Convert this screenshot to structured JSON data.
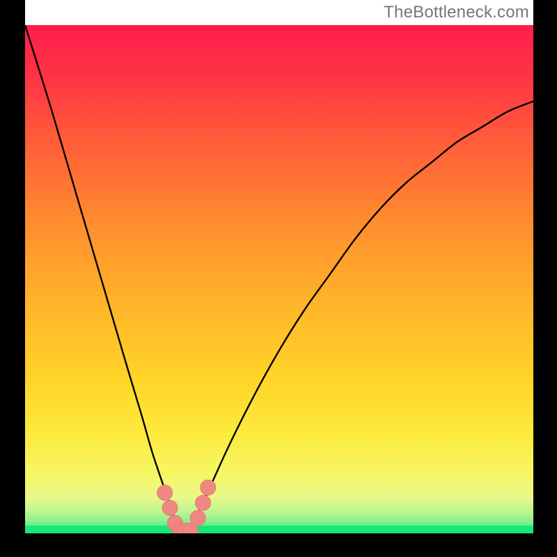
{
  "attribution": "TheBottleneck.com",
  "colors": {
    "frame": "#000000",
    "attribution_bg": "#ffffff",
    "attribution_text": "#757575",
    "curve": "#000000",
    "marker_fill": "#ef8783",
    "marker_stroke": "#e77874",
    "floor": "#17e87a"
  },
  "chart_data": {
    "type": "line",
    "title": "",
    "xlabel": "",
    "ylabel": "",
    "xlim": [
      0,
      100
    ],
    "ylim": [
      0,
      100
    ],
    "grid": false,
    "legend": false,
    "series": [
      {
        "name": "bottleneck-curve",
        "x": [
          0,
          5,
          10,
          15,
          20,
          23,
          25,
          27,
          29,
          30,
          31,
          33,
          35,
          40,
          45,
          50,
          55,
          60,
          65,
          70,
          75,
          80,
          85,
          90,
          95,
          100
        ],
        "values": [
          100,
          84,
          67,
          50,
          33,
          23,
          16,
          10,
          4,
          1,
          0,
          2,
          6,
          17,
          27,
          36,
          44,
          51,
          58,
          64,
          69,
          73,
          77,
          80,
          83,
          85
        ]
      }
    ],
    "annotations": {
      "name": "near-min-markers",
      "points": [
        {
          "x": 27.5,
          "y": 8
        },
        {
          "x": 28.5,
          "y": 5
        },
        {
          "x": 29.5,
          "y": 2
        },
        {
          "x": 30.5,
          "y": 0.5
        },
        {
          "x": 31.5,
          "y": 0.5
        },
        {
          "x": 32.5,
          "y": 0.5
        },
        {
          "x": 34.0,
          "y": 3
        },
        {
          "x": 35.0,
          "y": 6
        },
        {
          "x": 36.0,
          "y": 9
        }
      ]
    },
    "floor_band_y": 1.5
  }
}
